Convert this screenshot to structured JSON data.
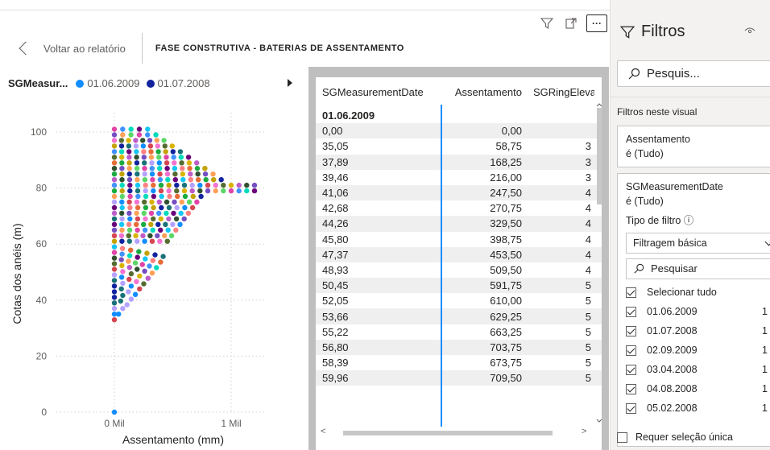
{
  "header": {
    "back_label": "Voltar ao relatório",
    "page_title": "FASE CONSTRUTIVA - BATERIAS DE ASSENTAMENTO"
  },
  "chart_title": {
    "field": "SGMeasur...",
    "legend": [
      {
        "label": "01.06.2009",
        "color": "#118dff"
      },
      {
        "label": "01.07.2008",
        "color": "#12239e"
      }
    ]
  },
  "chart_data": {
    "type": "scatter",
    "title": "",
    "xlabel": "Assentamento (mm)",
    "ylabel": "Cotas dos anéis (m)",
    "y_ticks": [
      "0",
      "20",
      "40",
      "60",
      "80",
      "100"
    ],
    "x_ticks": [
      "0 Mil",
      "1 Mil"
    ],
    "ylim": [
      0,
      105
    ],
    "grid": true,
    "point_colors": [
      "#118dff",
      "#12239e",
      "#e66c37",
      "#6b007b",
      "#e044a7",
      "#744ec2",
      "#d9b300",
      "#d64550",
      "#197278",
      "#1aab40",
      "#15c6f4",
      "#4092ff",
      "#ffa058",
      "#be5dc9",
      "#f472d0",
      "#b5a1ff",
      "#c4a200",
      "#ff8080",
      "#00dbbc",
      "#5bd667",
      "#2f4f2f",
      "#556b2f"
    ]
  },
  "table": {
    "headers": [
      "SGMeasurementDate",
      "Assentamento",
      "SGRingEleva"
    ],
    "group": "01.06.2009",
    "rows": [
      [
        "0,00",
        "0,00",
        ""
      ],
      [
        "35,05",
        "58,75",
        "3"
      ],
      [
        "37,89",
        "168,25",
        "3"
      ],
      [
        "39,46",
        "216,00",
        "3"
      ],
      [
        "41,06",
        "247,50",
        "4"
      ],
      [
        "42,68",
        "270,75",
        "4"
      ],
      [
        "44,26",
        "329,50",
        "4"
      ],
      [
        "45,80",
        "398,75",
        "4"
      ],
      [
        "47,37",
        "453,50",
        "4"
      ],
      [
        "48,93",
        "509,50",
        "4"
      ],
      [
        "50,45",
        "591,75",
        "5"
      ],
      [
        "52,05",
        "610,00",
        "5"
      ],
      [
        "53,66",
        "629,25",
        "5"
      ],
      [
        "55,22",
        "663,25",
        "5"
      ],
      [
        "56,80",
        "703,75",
        "5"
      ],
      [
        "58,39",
        "673,75",
        "5"
      ],
      [
        "59,96",
        "709,50",
        "5"
      ]
    ]
  },
  "filters": {
    "title": "Filtros",
    "search_placeholder": "Pesquis...",
    "section_label": "Filtros neste visual",
    "card1": {
      "field": "Assentamento",
      "value": "é (Tudo)"
    },
    "card2": {
      "field": "SGMeasurementDate",
      "value": "é (Tudo)",
      "type_label": "Tipo de filtro ⓘ",
      "type_value": "Filtragem básica",
      "search_placeholder": "Pesquisar",
      "select_all": "Selecionar tudo",
      "items": [
        {
          "label": "01.06.2009",
          "count": "1"
        },
        {
          "label": "01.07.2008",
          "count": "1"
        },
        {
          "label": "02.09.2009",
          "count": "1"
        },
        {
          "label": "03.04.2008",
          "count": "1"
        },
        {
          "label": "04.08.2008",
          "count": "1"
        },
        {
          "label": "05.02.2008",
          "count": "1"
        }
      ]
    },
    "single_select_label": "Requer seleção única"
  }
}
